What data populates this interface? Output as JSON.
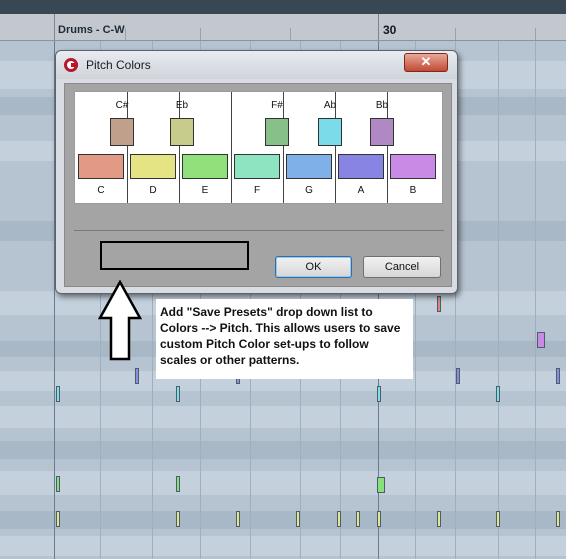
{
  "editor": {
    "track_label": "Drums - C-W",
    "bar_number": "30"
  },
  "dialog": {
    "title": "Pitch Colors",
    "close_label": "✕",
    "black_keys": [
      {
        "label": "C#",
        "color": "#c0a08a"
      },
      {
        "label": "Eb",
        "color": "#c8cc8a"
      },
      {
        "label": "F#",
        "color": "#88c08a"
      },
      {
        "label": "Ab",
        "color": "#7adce8"
      },
      {
        "label": "Bb",
        "color": "#b088c4"
      }
    ],
    "white_keys": [
      {
        "label": "C",
        "color": "#e39a84"
      },
      {
        "label": "D",
        "color": "#e4e485"
      },
      {
        "label": "E",
        "color": "#90e07c"
      },
      {
        "label": "F",
        "color": "#8ce4c0"
      },
      {
        "label": "G",
        "color": "#7fb0e8"
      },
      {
        "label": "A",
        "color": "#8884e4"
      },
      {
        "label": "B",
        "color": "#c88ae4"
      }
    ],
    "ok_label": "OK",
    "cancel_label": "Cancel"
  },
  "annotation": {
    "lines": [
      "Add \"Save Presets\" drop down list to",
      "Colors --> Pitch. This allows users to save",
      "custom Pitch Color set-ups to follow",
      "scales or other patterns."
    ]
  },
  "notes": [
    {
      "color": "#d98a6e"
    },
    {
      "color": "#d98a6e"
    },
    {
      "color": "#8a8ee0"
    },
    {
      "color": "#8a8ee0"
    },
    {
      "color": "#8a8ee0"
    },
    {
      "color": "#7ee0e4"
    },
    {
      "color": "#7ee0e4"
    },
    {
      "color": "#7ee0e4"
    },
    {
      "color": "#88e07a"
    },
    {
      "color": "#88e07a"
    },
    {
      "color": "#88e07a"
    },
    {
      "color": "#e4e48a"
    },
    {
      "color": "#c88ae4"
    }
  ]
}
